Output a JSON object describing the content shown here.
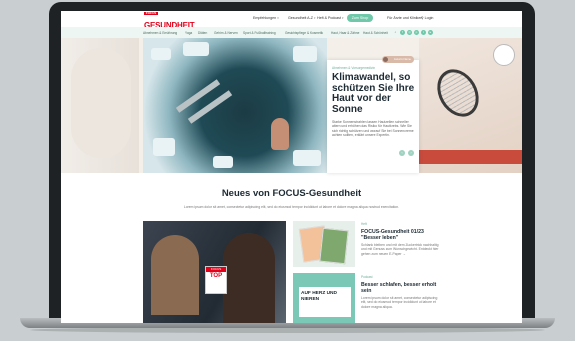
{
  "header": {
    "logo_small": "FOCUS",
    "logo": "GESUNDHEIT",
    "nav": [
      {
        "label": "Empfehlungen"
      },
      {
        "label": "Gesundheit A-Z"
      },
      {
        "label": "Heft & Podcast"
      }
    ],
    "shop_label": "Zum Shop",
    "right": [
      "Für Ärzte und Kliniken",
      "Login"
    ]
  },
  "categories": [
    "Abnehmen & Ernährung",
    "Yoga",
    "Diäten",
    "Gehirn & Nerven",
    "Sport & Fußballtraining",
    "Gesichtspflege & Kosmetik",
    "Haut, Haar & Zähne",
    "Haut & Schönheit"
  ],
  "social_icons": [
    "search-icon",
    "facebook-icon",
    "instagram-icon",
    "pinterest-icon",
    "twitter-icon",
    "youtube-icon"
  ],
  "hero": {
    "author_tag": "Autorin Name",
    "category": "Abnehmen & Vorsorgemedizin",
    "title": "Klimawandel, so schützen Sie Ihre Haut vor der Sonne",
    "text": "Starke Sonnenstrahlen lassen Hautzellen schneller altern und erhöhen das Risiko für Hautkrebs. Wie Sie sich richtig schützen und worauf Sie bei Sonnencreme achten sollten, erklärt unsere Expertin.",
    "prev": "‹",
    "next": "›"
  },
  "section": {
    "title": "Neues von FOCUS-Gesundheit",
    "subtitle": "Lorem ipsum dolor sit amet, consectetur adipiscing elit, sed do eiusmod tempor incididunt ut labore et dolore magna aliqua nostrud exercitation."
  },
  "articles": {
    "big_badge_small": "FOCUS",
    "big_badge": "TOP",
    "a1": {
      "category": "Heft",
      "title": "FOCUS-Gesundheit 01/23 \"Besser leben\"",
      "text": "Schlank bleiben und mit dem Zuckertrick nachhaltig und mit Genuss zum Wunschgewicht. Entdeckt hier gehen zum neuen E-Paper →"
    },
    "a2": {
      "thumb_text": "AUF HERZ UND NIEREN",
      "category": "Podcast",
      "title": "Besser schlafen, besser erholt sein",
      "text": "Lorem ipsum dolor sit amet, consectetur adipiscing elit, sed do eiusmod tempor incididunt ut labore et dolore magna aliqua."
    }
  },
  "colors": {
    "brand": "#e2001a",
    "accent": "#6fc8a9",
    "title": "#1c2a33"
  }
}
